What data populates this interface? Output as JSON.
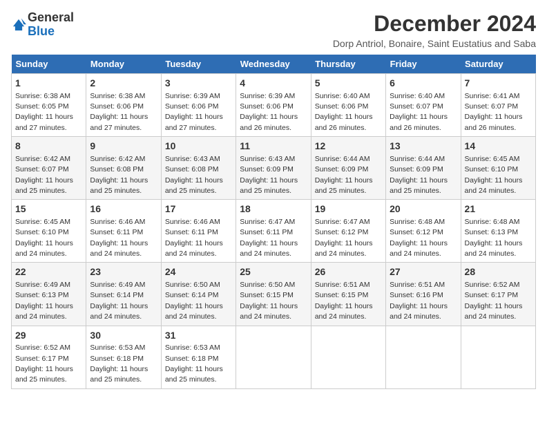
{
  "header": {
    "logo_general": "General",
    "logo_blue": "Blue",
    "title": "December 2024",
    "subtitle": "Dorp Antriol, Bonaire, Saint Eustatius and Saba"
  },
  "days_of_week": [
    "Sunday",
    "Monday",
    "Tuesday",
    "Wednesday",
    "Thursday",
    "Friday",
    "Saturday"
  ],
  "weeks": [
    [
      {
        "num": "1",
        "sunrise": "6:38 AM",
        "sunset": "6:05 PM",
        "daylight": "11 hours and 27 minutes."
      },
      {
        "num": "2",
        "sunrise": "6:38 AM",
        "sunset": "6:06 PM",
        "daylight": "11 hours and 27 minutes."
      },
      {
        "num": "3",
        "sunrise": "6:39 AM",
        "sunset": "6:06 PM",
        "daylight": "11 hours and 27 minutes."
      },
      {
        "num": "4",
        "sunrise": "6:39 AM",
        "sunset": "6:06 PM",
        "daylight": "11 hours and 26 minutes."
      },
      {
        "num": "5",
        "sunrise": "6:40 AM",
        "sunset": "6:06 PM",
        "daylight": "11 hours and 26 minutes."
      },
      {
        "num": "6",
        "sunrise": "6:40 AM",
        "sunset": "6:07 PM",
        "daylight": "11 hours and 26 minutes."
      },
      {
        "num": "7",
        "sunrise": "6:41 AM",
        "sunset": "6:07 PM",
        "daylight": "11 hours and 26 minutes."
      }
    ],
    [
      {
        "num": "8",
        "sunrise": "6:42 AM",
        "sunset": "6:07 PM",
        "daylight": "11 hours and 25 minutes."
      },
      {
        "num": "9",
        "sunrise": "6:42 AM",
        "sunset": "6:08 PM",
        "daylight": "11 hours and 25 minutes."
      },
      {
        "num": "10",
        "sunrise": "6:43 AM",
        "sunset": "6:08 PM",
        "daylight": "11 hours and 25 minutes."
      },
      {
        "num": "11",
        "sunrise": "6:43 AM",
        "sunset": "6:09 PM",
        "daylight": "11 hours and 25 minutes."
      },
      {
        "num": "12",
        "sunrise": "6:44 AM",
        "sunset": "6:09 PM",
        "daylight": "11 hours and 25 minutes."
      },
      {
        "num": "13",
        "sunrise": "6:44 AM",
        "sunset": "6:09 PM",
        "daylight": "11 hours and 25 minutes."
      },
      {
        "num": "14",
        "sunrise": "6:45 AM",
        "sunset": "6:10 PM",
        "daylight": "11 hours and 24 minutes."
      }
    ],
    [
      {
        "num": "15",
        "sunrise": "6:45 AM",
        "sunset": "6:10 PM",
        "daylight": "11 hours and 24 minutes."
      },
      {
        "num": "16",
        "sunrise": "6:46 AM",
        "sunset": "6:11 PM",
        "daylight": "11 hours and 24 minutes."
      },
      {
        "num": "17",
        "sunrise": "6:46 AM",
        "sunset": "6:11 PM",
        "daylight": "11 hours and 24 minutes."
      },
      {
        "num": "18",
        "sunrise": "6:47 AM",
        "sunset": "6:11 PM",
        "daylight": "11 hours and 24 minutes."
      },
      {
        "num": "19",
        "sunrise": "6:47 AM",
        "sunset": "6:12 PM",
        "daylight": "11 hours and 24 minutes."
      },
      {
        "num": "20",
        "sunrise": "6:48 AM",
        "sunset": "6:12 PM",
        "daylight": "11 hours and 24 minutes."
      },
      {
        "num": "21",
        "sunrise": "6:48 AM",
        "sunset": "6:13 PM",
        "daylight": "11 hours and 24 minutes."
      }
    ],
    [
      {
        "num": "22",
        "sunrise": "6:49 AM",
        "sunset": "6:13 PM",
        "daylight": "11 hours and 24 minutes."
      },
      {
        "num": "23",
        "sunrise": "6:49 AM",
        "sunset": "6:14 PM",
        "daylight": "11 hours and 24 minutes."
      },
      {
        "num": "24",
        "sunrise": "6:50 AM",
        "sunset": "6:14 PM",
        "daylight": "11 hours and 24 minutes."
      },
      {
        "num": "25",
        "sunrise": "6:50 AM",
        "sunset": "6:15 PM",
        "daylight": "11 hours and 24 minutes."
      },
      {
        "num": "26",
        "sunrise": "6:51 AM",
        "sunset": "6:15 PM",
        "daylight": "11 hours and 24 minutes."
      },
      {
        "num": "27",
        "sunrise": "6:51 AM",
        "sunset": "6:16 PM",
        "daylight": "11 hours and 24 minutes."
      },
      {
        "num": "28",
        "sunrise": "6:52 AM",
        "sunset": "6:17 PM",
        "daylight": "11 hours and 24 minutes."
      }
    ],
    [
      {
        "num": "29",
        "sunrise": "6:52 AM",
        "sunset": "6:17 PM",
        "daylight": "11 hours and 25 minutes."
      },
      {
        "num": "30",
        "sunrise": "6:53 AM",
        "sunset": "6:18 PM",
        "daylight": "11 hours and 25 minutes."
      },
      {
        "num": "31",
        "sunrise": "6:53 AM",
        "sunset": "6:18 PM",
        "daylight": "11 hours and 25 minutes."
      },
      null,
      null,
      null,
      null
    ]
  ]
}
